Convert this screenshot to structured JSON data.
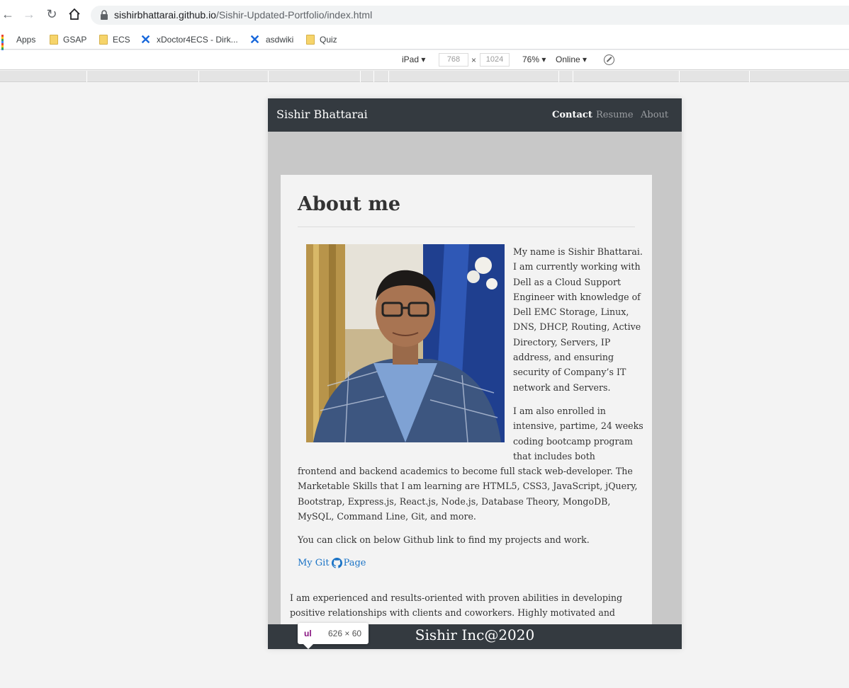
{
  "browser": {
    "url_host": "sishirbhattarai.github.io",
    "url_path": "/Sishir-Updated-Portfolio/index.html",
    "bookmarks": [
      "Apps",
      "GSAP",
      "ECS",
      "xDoctor4ECS - Dirk...",
      "asdwiki",
      "Quiz"
    ]
  },
  "devtools": {
    "device": "iPad",
    "width": "768",
    "height": "1024",
    "zoom": "76%",
    "network": "Online",
    "times": "×"
  },
  "site": {
    "brand": "Sishir Bhattarai",
    "nav": [
      "Contact",
      "Resume",
      "About"
    ],
    "heading": "About me",
    "para1": "My name is Sishir Bhattarai. I am currently working with Dell as a Cloud Support Engineer with knowledge of Dell EMC Storage, Linux, DNS, DHCP, Routing, Active Directory, Servers, IP address, and ensuring security of Company’s IT network and Servers.",
    "para2_right": "I am also enrolled in intensive, partime, 24 weeks coding bootcamp program that includes both",
    "para2_full": "frontend and backend academics to become full stack web-developer. The Marketable Skills that I am learning are HTML5, CSS3, JavaScript, jQuery, Bootstrap, Express.js, React.js, Node.js, Database Theory, MongoDB, MySQL, Command Line, Git, and more.",
    "para3": "You can click on below Github link to find my projects and work.",
    "git_link_pre": "My Git",
    "git_link_post": "Page",
    "para4": "I am experienced and results-oriented with proven abilities in developing positive relationships with clients and coworkers. Highly motivated and energetic, I strive",
    "footer": "Sishir Inc@2020"
  },
  "tooltip": {
    "tag": "ul",
    "size": "626 × 60"
  },
  "colors": {
    "navbar": "#343a40",
    "link": "#1a73c6",
    "page_bg": "#c8c8c8"
  }
}
